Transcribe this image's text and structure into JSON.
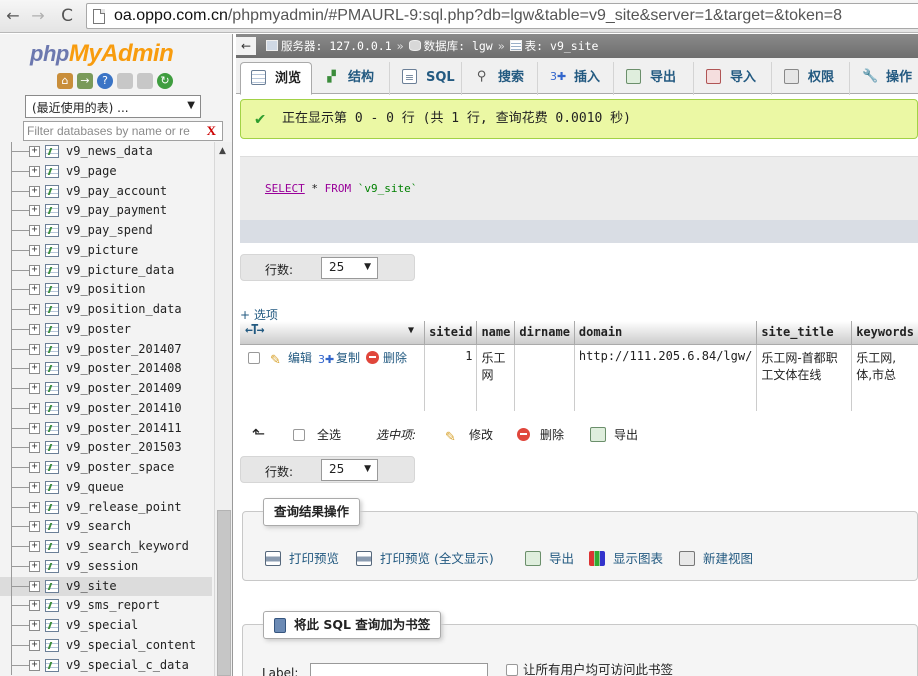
{
  "browser": {
    "back": "←",
    "forward": "→",
    "reload": "C",
    "url_host": "oa.oppo.com.cn",
    "url_rest": "/phpmyadmin/#PMAURL-9:sql.php?db=lgw&table=v9_site&server=1&target=&token=8"
  },
  "sidebar": {
    "logo_php": "php",
    "logo_my": "My",
    "logo_admin": "Admin",
    "recent_label": "(最近使用的表) ...",
    "filter_placeholder": "Filter databases by name or re",
    "filter_clear": "X",
    "tables": [
      "v9_news_data",
      "v9_page",
      "v9_pay_account",
      "v9_pay_payment",
      "v9_pay_spend",
      "v9_picture",
      "v9_picture_data",
      "v9_position",
      "v9_position_data",
      "v9_poster",
      "v9_poster_201407",
      "v9_poster_201408",
      "v9_poster_201409",
      "v9_poster_201410",
      "v9_poster_201411",
      "v9_poster_201503",
      "v9_poster_space",
      "v9_queue",
      "v9_release_point",
      "v9_search",
      "v9_search_keyword",
      "v9_session",
      "v9_site",
      "v9_sms_report",
      "v9_special",
      "v9_special_content",
      "v9_special_c_data"
    ],
    "selected_table": "v9_site"
  },
  "topbar": {
    "collapse": "←",
    "server": "服务器: 127.0.0.1",
    "database": "数据库: lgw",
    "table": "表: v9_site",
    "sep": "»"
  },
  "tabs": [
    {
      "label": "浏览",
      "icon": "browse-icon"
    },
    {
      "label": "结构",
      "icon": "structure-icon"
    },
    {
      "label": "SQL",
      "icon": "sql-icon"
    },
    {
      "label": "搜索",
      "icon": "search-icon"
    },
    {
      "label": "插入",
      "icon": "insert-icon"
    },
    {
      "label": "导出",
      "icon": "export-icon"
    },
    {
      "label": "导入",
      "icon": "import-icon"
    },
    {
      "label": "权限",
      "icon": "privileges-icon"
    },
    {
      "label": "操作",
      "icon": "operations-icon"
    }
  ],
  "message": {
    "success": "正在显示第 0 - 0 行 (共 1 行, 查询花费 0.0010 秒)"
  },
  "sql": {
    "select": "SELECT",
    "star": " * ",
    "from": "FROM",
    "table": " `v9_site`"
  },
  "rows": {
    "label": "行数:",
    "value": "25"
  },
  "options_link": "+ 选项",
  "table": {
    "columns": [
      "siteid",
      "name",
      "dirname",
      "domain",
      "site_title",
      "keywords"
    ],
    "row": {
      "edit": "编辑",
      "copy": "复制",
      "delete": "删除",
      "siteid": "1",
      "name": "乐工网",
      "dirname": "",
      "domain": "http://111.205.6.84/lgw/",
      "site_title": "乐工网-首都职工文体在线",
      "keywords": "乐工网,体,市总"
    }
  },
  "bulk": {
    "check_all": "全选",
    "with_selected": "选中项:",
    "edit": "修改",
    "delete": "删除",
    "export": "导出"
  },
  "query_ops": {
    "legend": "查询结果操作",
    "print": "打印预览",
    "print_full": "打印预览 (全文显示)",
    "export": "导出",
    "chart": "显示图表",
    "view": "新建视图"
  },
  "bookmark": {
    "legend": "将此 SQL 查询加为书签",
    "label": "Label:",
    "share": "让所有用户均可访问此书签"
  }
}
